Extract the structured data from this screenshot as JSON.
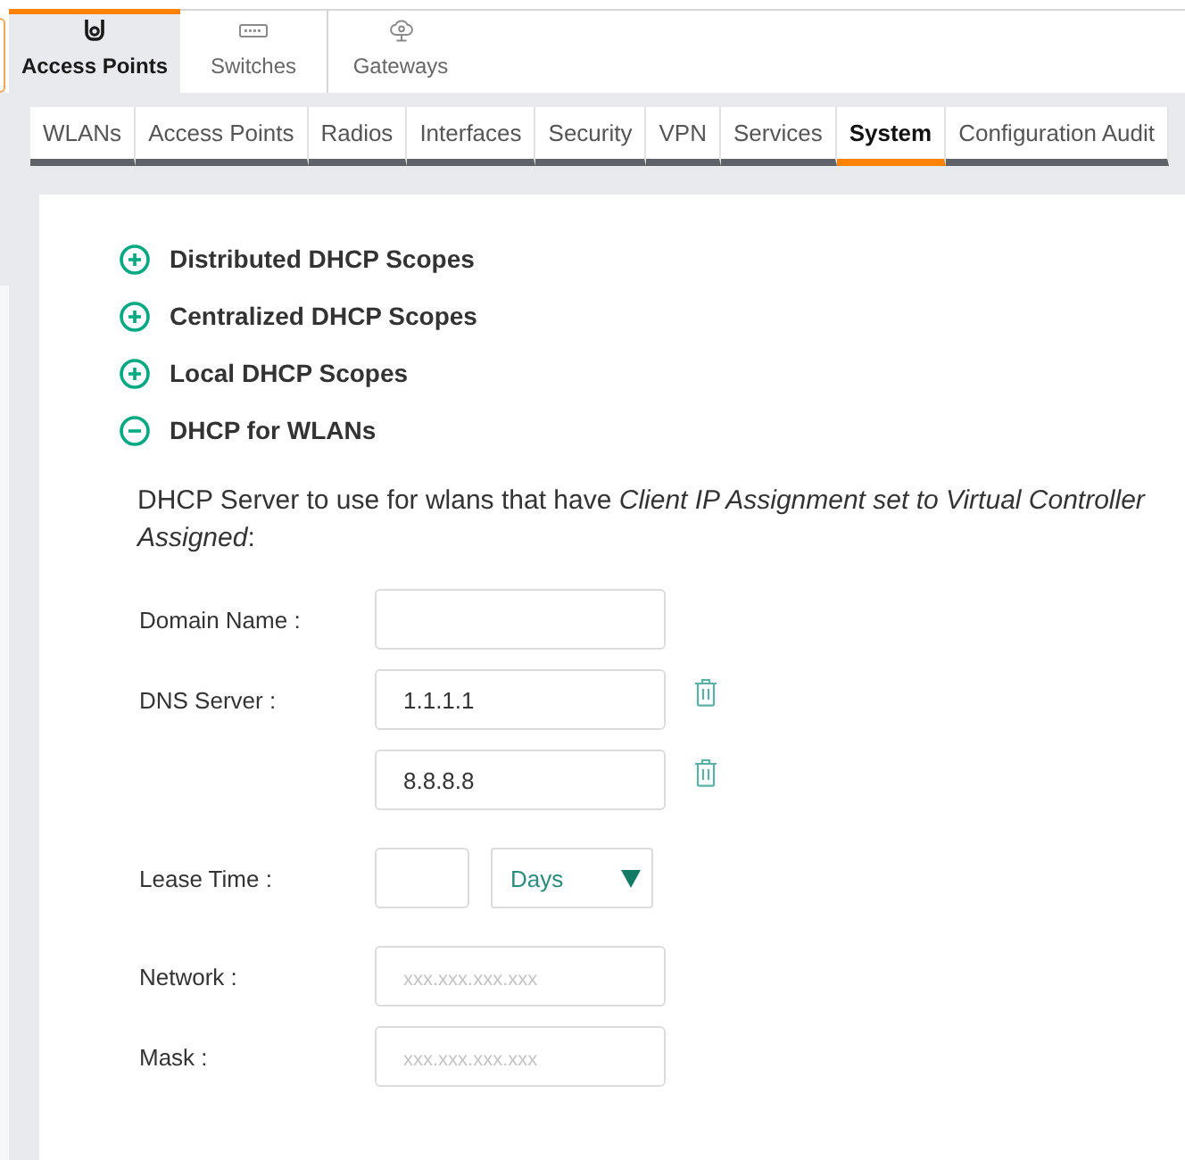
{
  "device_tabs": [
    {
      "kind": "access_point",
      "label": "Access Points",
      "selected": true
    },
    {
      "kind": "switch",
      "label": "Switches",
      "selected": false
    },
    {
      "kind": "gateway",
      "label": "Gateways",
      "selected": false
    }
  ],
  "config_tabs": [
    {
      "label": "WLANs",
      "selected": false
    },
    {
      "label": "Access Points",
      "selected": false
    },
    {
      "label": "Radios",
      "selected": false
    },
    {
      "label": "Interfaces",
      "selected": false
    },
    {
      "label": "Security",
      "selected": false
    },
    {
      "label": "VPN",
      "selected": false
    },
    {
      "label": "Services",
      "selected": false
    },
    {
      "label": "System",
      "selected": true
    },
    {
      "label": "Configuration Audit",
      "selected": false
    }
  ],
  "sections": [
    {
      "title": "Distributed DHCP Scopes",
      "expanded": false
    },
    {
      "title": "Centralized DHCP Scopes",
      "expanded": false
    },
    {
      "title": "Local DHCP Scopes",
      "expanded": false
    },
    {
      "title": "DHCP for WLANs",
      "expanded": true,
      "description": "DHCP Server to use for wlans that have *Client IP Assignment set to Virtual Controller Assigned*:",
      "fields": [
        {
          "kind": "text",
          "label": "Domain Name :"
        },
        {
          "kind": "list",
          "label": "DNS Server :",
          "entries": [
            {
              "value": "1.1.1.1"
            },
            {
              "value": "8.8.8.8"
            }
          ]
        },
        {
          "kind": "duration",
          "label": "Lease Time :",
          "unit": "Days"
        },
        {
          "kind": "text",
          "label": "Network :",
          "placeholder": "xxx.xxx.xxx.xxx"
        },
        {
          "kind": "text",
          "label": "Mask :",
          "placeholder": "xxx.xxx.xxx.xxx"
        }
      ]
    }
  ]
}
